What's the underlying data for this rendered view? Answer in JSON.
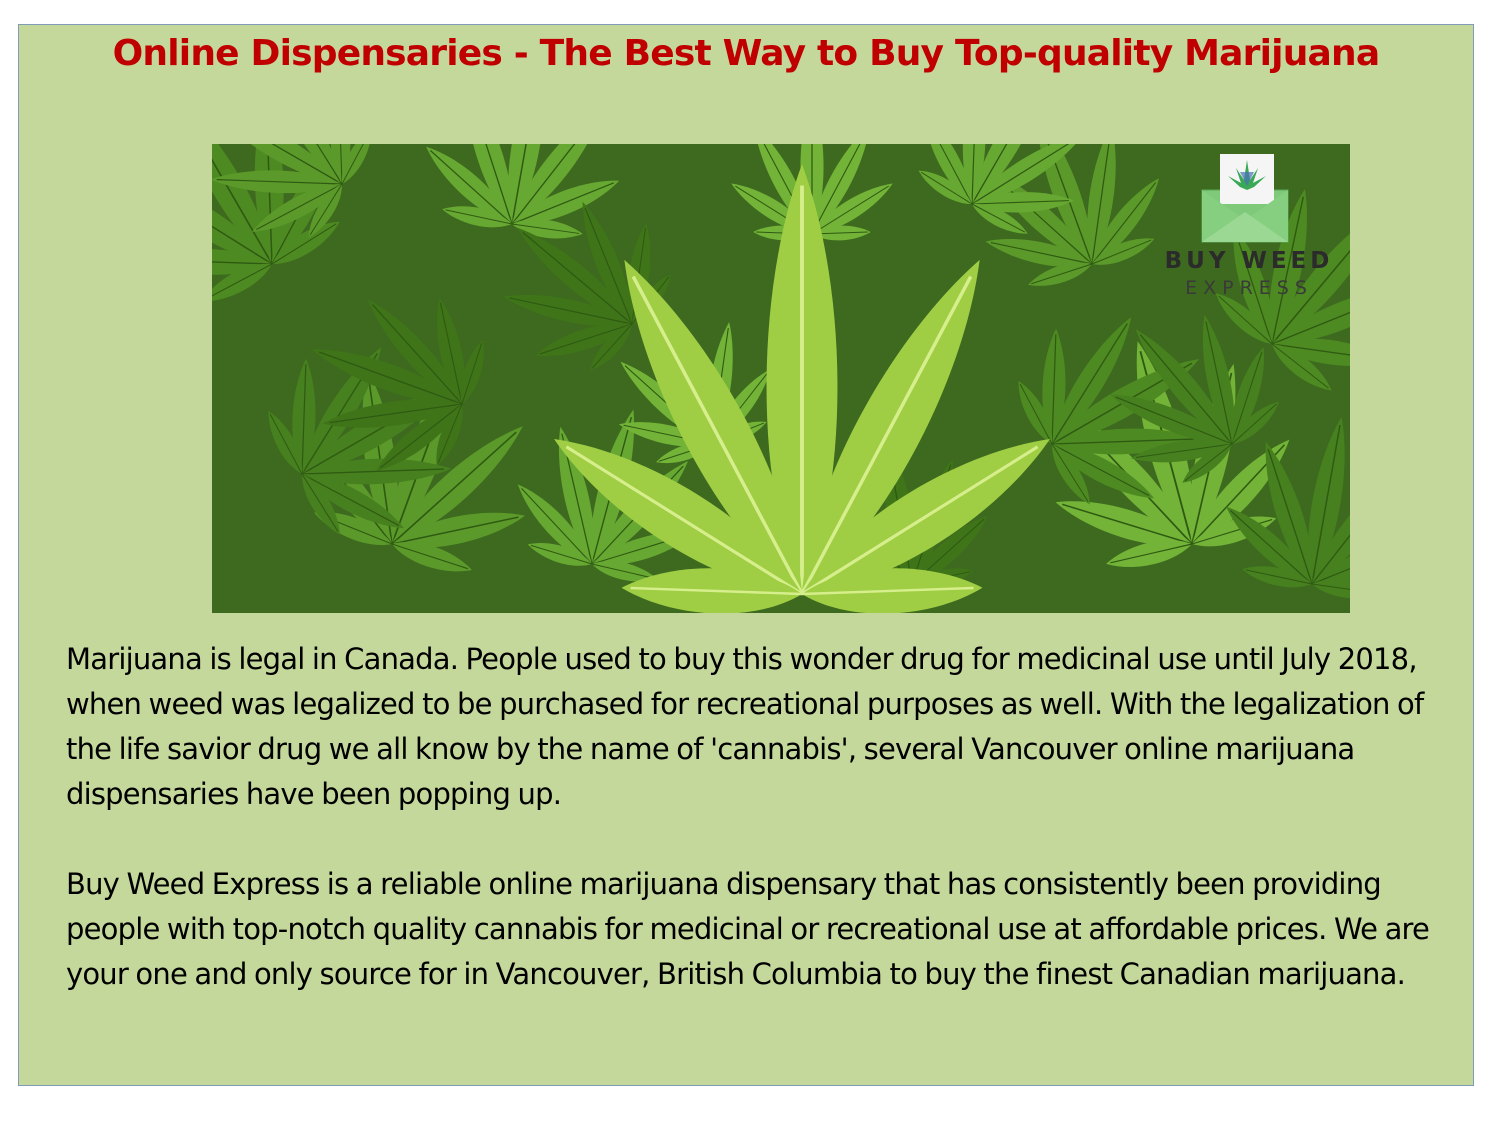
{
  "title": "Online Dispensaries - The Best Way to Buy Top-quality Marijuana",
  "image": {
    "subject": "cannabis-leaves",
    "logo": {
      "line1": "BUY WEED",
      "line2": "EXPRESS",
      "icon": "envelope-leaf-icon"
    }
  },
  "paragraphs": [
    "Marijuana is legal in Canada. People used to buy this wonder drug for medicinal use until July 2018, when weed was legalized to be purchased for recreational purposes as well. With the legalization of the life savior drug we all know by the name of 'cannabis', several Vancouver online marijuana dispensaries have been popping up.",
    "Buy Weed Express is a reliable online marijuana dispensary that has consistently been providing people with top-notch quality cannabis for medicinal or recreational use at affordable prices. We are your one and only source for in Vancouver, British Columbia to buy the finest Canadian marijuana."
  ],
  "colors": {
    "background": "#c5d89c",
    "title": "#c00000",
    "border": "#7f9cb8"
  }
}
